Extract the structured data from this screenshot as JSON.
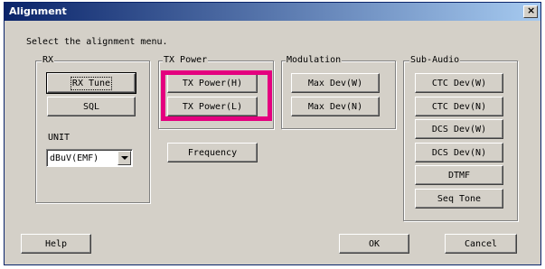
{
  "window": {
    "title": "Alignment",
    "close_label": "×"
  },
  "prompt": "Select the alignment menu.",
  "rx": {
    "label": "RX",
    "rx_tune": "RX Tune",
    "sql": "SQL",
    "unit_label": "UNIT",
    "unit_value": "dBuV(EMF)"
  },
  "tx_power": {
    "label": "TX Power",
    "high": "TX Power(H)",
    "low": "TX Power(L)",
    "frequency": "Frequency"
  },
  "modulation": {
    "label": "Modulation",
    "max_dev_w": "Max Dev(W)",
    "max_dev_n": "Max Dev(N)"
  },
  "sub_audio": {
    "label": "Sub-Audio",
    "ctc_w": "CTC Dev(W)",
    "ctc_n": "CTC Dev(N)",
    "dcs_w": "DCS Dev(W)",
    "dcs_n": "DCS Dev(N)",
    "dtmf": "DTMF",
    "seq_tone": "Seq Tone"
  },
  "footer": {
    "help": "Help",
    "ok": "OK",
    "cancel": "Cancel"
  },
  "colors": {
    "highlight": "#e4007f",
    "title_bar": "#0a246a",
    "dialog_bg": "#d4d0c8"
  }
}
